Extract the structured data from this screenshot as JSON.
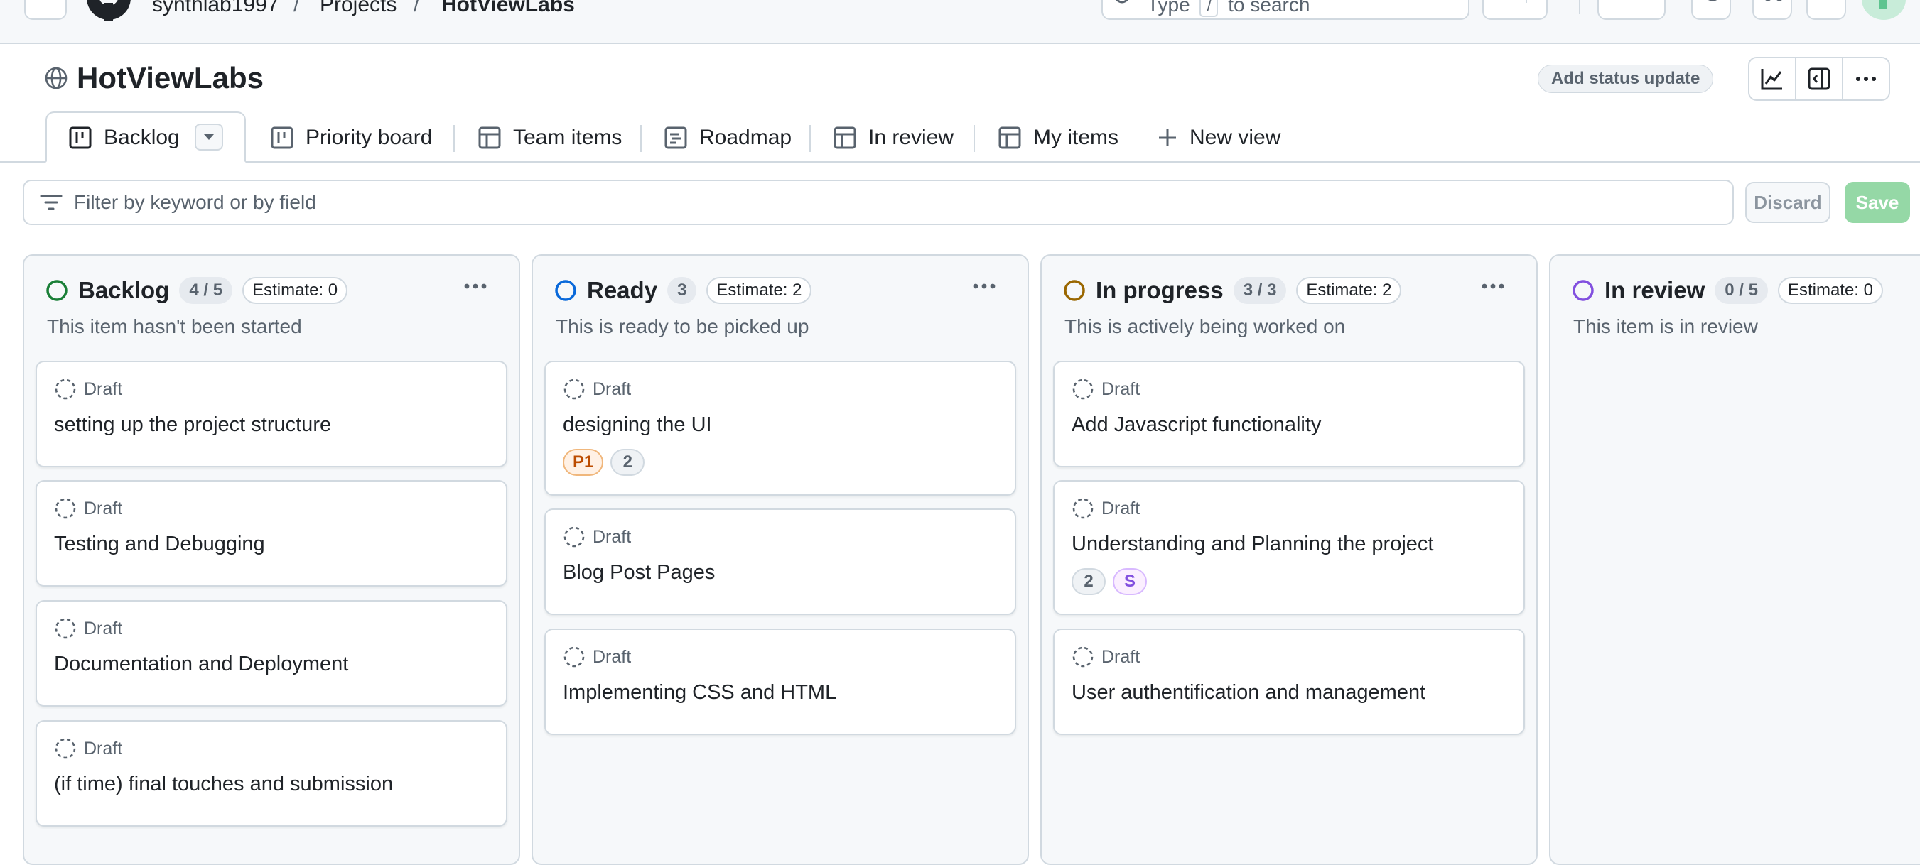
{
  "header": {
    "crumbs": [
      "synthlab1997",
      "/",
      "Projects",
      "/",
      "HotViewLabs"
    ],
    "search_placeholder_pre": "Type",
    "search_key": "/",
    "search_placeholder_post": "to search"
  },
  "project": {
    "title": "HotViewLabs",
    "status_update_label": "Add status update"
  },
  "views": [
    {
      "label": "Backlog",
      "icon": "board-icon",
      "active": true
    },
    {
      "label": "Priority board",
      "icon": "board-icon"
    },
    {
      "label": "Team items",
      "icon": "table-icon"
    },
    {
      "label": "Roadmap",
      "icon": "roadmap-icon"
    },
    {
      "label": "In review",
      "icon": "table-icon"
    },
    {
      "label": "My items",
      "icon": "table-icon"
    },
    {
      "label": "New view",
      "icon": "plus-icon"
    }
  ],
  "filter": {
    "placeholder": "Filter by keyword or by field",
    "discard_label": "Discard",
    "save_label": "Save"
  },
  "columns": [
    {
      "name": "Backlog",
      "count": "4 / 5",
      "estimate": "Estimate: 0",
      "description": "This item hasn't been started",
      "color": "#1a7f37",
      "cards": [
        {
          "type": "Draft",
          "title": "setting up the project structure"
        },
        {
          "type": "Draft",
          "title": "Testing and Debugging"
        },
        {
          "type": "Draft",
          "title": "Documentation and Deployment"
        },
        {
          "type": "Draft",
          "title": "(if time) final touches and submission"
        }
      ]
    },
    {
      "name": "Ready",
      "count": "3",
      "estimate": "Estimate: 2",
      "description": "This is ready to be picked up",
      "color": "#0969da",
      "cards": [
        {
          "type": "Draft",
          "title": "designing the UI",
          "tags": [
            "P1",
            "2"
          ]
        },
        {
          "type": "Draft",
          "title": "Blog Post Pages"
        },
        {
          "type": "Draft",
          "title": "Implementing CSS and HTML"
        }
      ]
    },
    {
      "name": "In progress",
      "count": "3 / 3",
      "estimate": "Estimate: 2",
      "description": "This is actively being worked on",
      "color": "#9a6700",
      "cards": [
        {
          "type": "Draft",
          "title": "Add Javascript functionality"
        },
        {
          "type": "Draft",
          "title": "Understanding and Planning the project",
          "tags": [
            "2",
            "S"
          ]
        },
        {
          "type": "Draft",
          "title": "User authentification and management"
        }
      ]
    },
    {
      "name": "In review",
      "count": "0 / 5",
      "estimate": "Estimate: 0",
      "description": "This item is in review",
      "color": "#8250df",
      "cards": []
    }
  ]
}
